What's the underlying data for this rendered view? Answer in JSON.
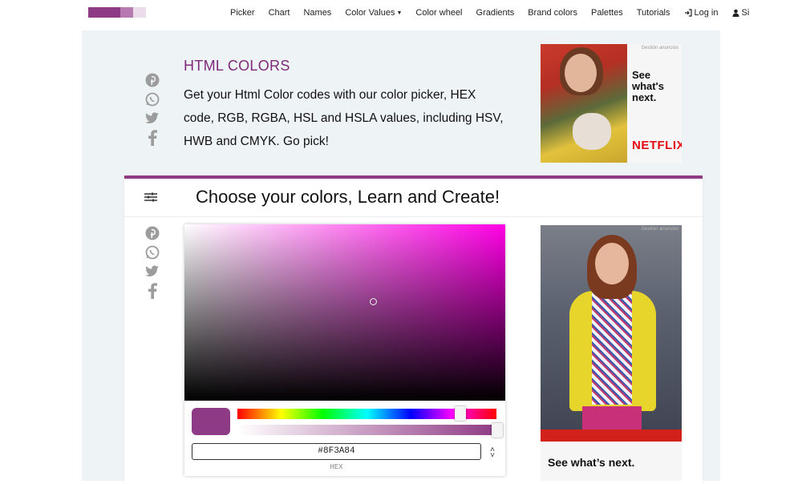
{
  "colors": {
    "accent": "#8f3a84",
    "title": "#7d2a78",
    "selected": "#8F3A84",
    "netflix": "#e50914"
  },
  "logo": {
    "blocks": [
      "#8f3a84",
      "#8f3a84",
      "#b67ab0",
      "#ecdcea"
    ]
  },
  "nav": {
    "items": [
      {
        "label": "Picker"
      },
      {
        "label": "Chart"
      },
      {
        "label": "Names"
      },
      {
        "label": "Color Values",
        "dropdown": true
      },
      {
        "label": "Color wheel"
      },
      {
        "label": "Gradients"
      },
      {
        "label": "Brand colors"
      },
      {
        "label": "Palettes"
      },
      {
        "label": "Tutorials"
      }
    ],
    "login": "Log in",
    "signup": "Si",
    "login_icon": "login-icon",
    "signup_icon": "user-icon"
  },
  "share_icons": [
    "pinterest-icon",
    "whatsapp-icon",
    "twitter-icon",
    "facebook-icon"
  ],
  "hero": {
    "title": "HTML COLORS",
    "text": "Get your Html Color codes with our color picker, HEX code, RGB, RGBA, HSL and HSLA values, including HSV, HWB and CMYK. Go pick!"
  },
  "ad_top": {
    "tag": "Gestión anuncios",
    "tagline": "See what's next.",
    "brand": "NETFLIX"
  },
  "card": {
    "title": "Choose your colors, Learn and Create!",
    "menu_icon": "sliders-icon"
  },
  "picker": {
    "hex_value": "#8F3A84",
    "format_label": "HEX",
    "hue_level": 0.86,
    "alpha_level": 1.0,
    "saturation_level": 0.58,
    "brightness_level": 0.56
  },
  "ad_side": {
    "tag": "Gestión anuncios",
    "tagline": "See what’s next."
  }
}
